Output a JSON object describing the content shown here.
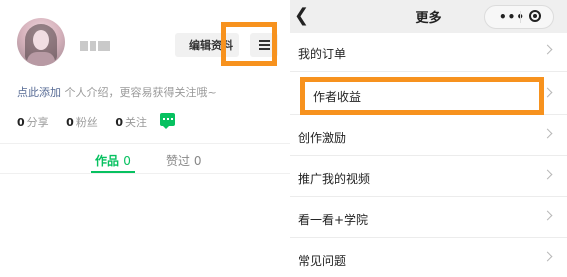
{
  "profile": {
    "edit_label": "编辑资料",
    "intro_link": "点此添加",
    "intro_hint": "个人介绍，更容易获得关注哦~",
    "stats": [
      {
        "count": "0",
        "label": "分享"
      },
      {
        "count": "0",
        "label": "粉丝"
      },
      {
        "count": "0",
        "label": "关注"
      }
    ],
    "tabs": [
      {
        "label": "作品",
        "count": "0",
        "active": true
      },
      {
        "label": "赞过",
        "count": "0",
        "active": false
      }
    ]
  },
  "more_page": {
    "title": "更多",
    "capsule_dots": "•••",
    "items": [
      {
        "label": "我的订单"
      },
      {
        "label": "作者收益"
      },
      {
        "label": "创作激励"
      },
      {
        "label": "推广我的视频"
      },
      {
        "label": "看一看+学院"
      },
      {
        "label": "常见问题"
      }
    ]
  },
  "colors": {
    "accent_green": "#07c160",
    "highlight_orange": "#f7921e",
    "link_blue": "#576b95"
  },
  "icons": [
    "hamburger-menu-icon",
    "message-icon",
    "back-arrow-icon",
    "more-dots-icon",
    "close-target-icon",
    "chevron-right-icon"
  ]
}
